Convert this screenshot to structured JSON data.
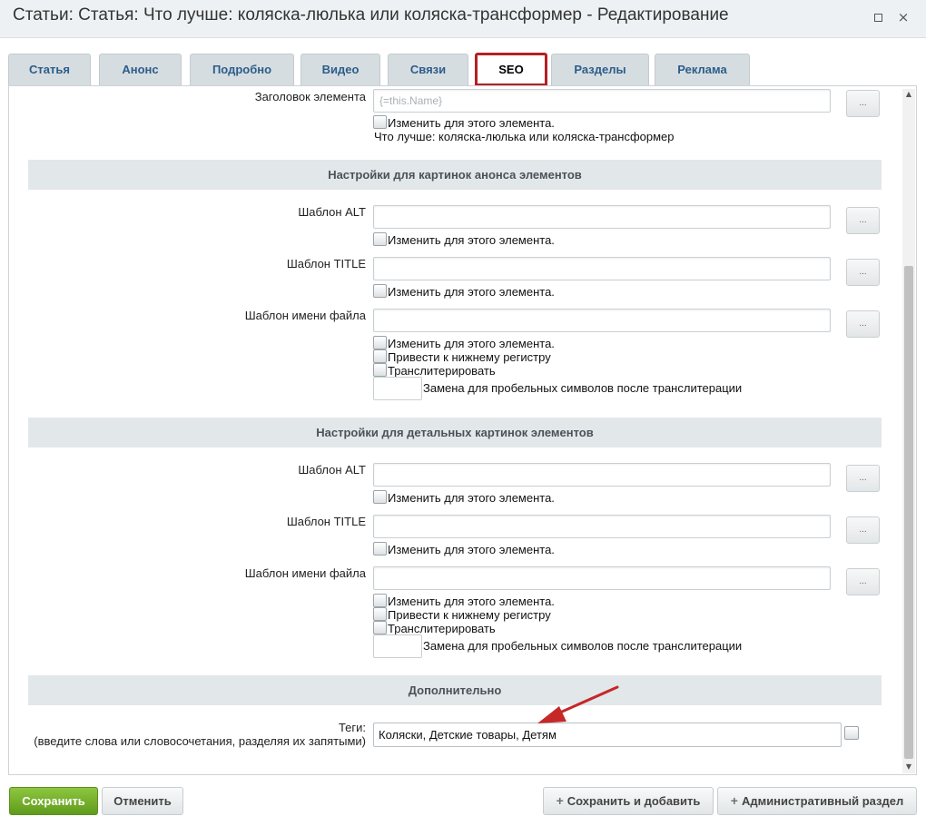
{
  "window": {
    "title": "Статьи: Статья: Что лучше: коляска-люлька или коляска-трансформер - Редактирование",
    "maximize_icon": "maximize-icon",
    "close_icon": "close-icon",
    "close_glyph": "×"
  },
  "tabs": [
    {
      "label": "Статья",
      "active": false
    },
    {
      "label": "Анонс",
      "active": false
    },
    {
      "label": "Подробно",
      "active": false
    },
    {
      "label": "Видео",
      "active": false
    },
    {
      "label": "Связи",
      "active": false
    },
    {
      "label": "SEO",
      "active": true
    },
    {
      "label": "Разделы",
      "active": false
    },
    {
      "label": "Реклама",
      "active": false
    }
  ],
  "accent_color": "#b51f24",
  "top_field": {
    "label": "Заголовок элемента",
    "value": "{=this.Name}",
    "dots": "...",
    "checkbox_label": "Изменить для этого элемента.",
    "computed_text": "Что лучше: коляска-люлька или коляска-трансформер"
  },
  "announce_section": {
    "heading": "Настройки для картинок анонса элементов",
    "alt_label": "Шаблон ALT",
    "title_label": "Шаблон TITLE",
    "filename_label": "Шаблон имени файла",
    "checkbox_change": "Изменить для этого элемента.",
    "checkbox_lower": "Привести к нижнему регистру",
    "checkbox_translit": "Транслитерировать",
    "space_replace_label": "Замена для пробельных символов после транслитерации",
    "dots": "..."
  },
  "detail_section": {
    "heading": "Настройки для детальных картинок элементов",
    "alt_label": "Шаблон ALT",
    "title_label": "Шаблон TITLE",
    "filename_label": "Шаблон имени файла",
    "checkbox_change": "Изменить для этого элемента.",
    "checkbox_lower": "Привести к нижнему регистру",
    "checkbox_translit": "Транслитерировать",
    "space_replace_label": "Замена для пробельных символов после транслитерации",
    "dots": "..."
  },
  "extra_section": {
    "heading": "Дополнительно",
    "tags_label": "Теги:",
    "tags_hint": "(введите слова или словосочетания, разделяя их запятыми)",
    "tags_value": "Коляски, Детские товары, Детям"
  },
  "footer": {
    "save": "Сохранить",
    "cancel": "Отменить",
    "save_add": "Сохранить и добавить",
    "admin_section": "Административный раздел",
    "plus_glyph": "+"
  }
}
